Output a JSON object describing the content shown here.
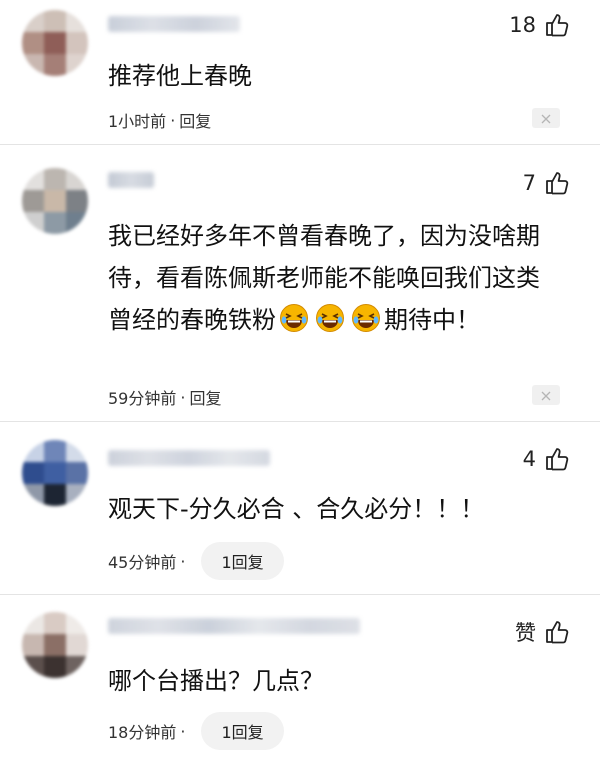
{
  "comments": [
    {
      "likes": "18",
      "text": "推荐他上春晚",
      "time": "1小时前",
      "dot": "·",
      "reply": "回复"
    },
    {
      "likes": "7",
      "text_before_emoji": "我已经好多年不曾看春晚了，因为没啥期待，看看陈佩斯老师能不能唤回我们这类曾经的春晚铁粉",
      "text_after_emoji": "期待中！",
      "emoji_icon": "laughing-tears-emoji",
      "time": "59分钟前",
      "dot": "·",
      "reply": "回复"
    },
    {
      "likes": "4",
      "text": "观天下-分久必合 、合久必分！！！",
      "time": "45分钟前",
      "dot": "·",
      "reply": "1回复"
    },
    {
      "likes": "赞",
      "text": "哪个台播出？几点？",
      "time": "18分钟前",
      "dot": "·",
      "reply": "1回复"
    }
  ],
  "colors": {
    "background": "#ffffff",
    "text": "#111111",
    "meta": "#333333",
    "pill": "#f2f2f2"
  }
}
